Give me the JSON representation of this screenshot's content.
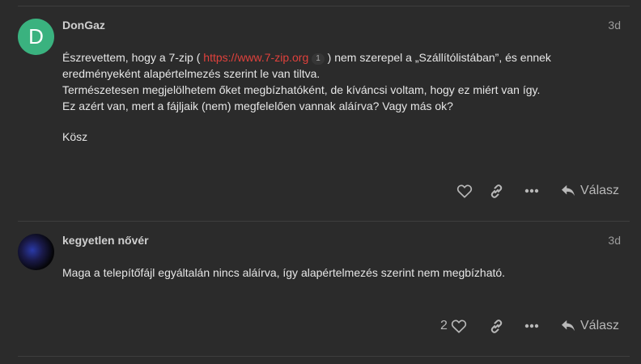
{
  "posts": [
    {
      "avatar_letter": "D",
      "username": "DonGaz",
      "date": "3d",
      "body": {
        "line1_before": "Észrevettem, hogy a 7-zip ( ",
        "link_text": "https://www.7-zip.org",
        "link_count": "1",
        "line1_after": " ) nem szerepel a „Szállítólistában”, és ennek eredményeként alapértelmezés szerint le van tiltva.",
        "line2": "Természetesen megjelölhetem őket megbízhatóként, de kíváncsi voltam, hogy ez miért van így.",
        "line3": "Ez azért van, mert a fájljaik (nem) megfelelően vannak aláírva? Vagy más ok?",
        "para2": "Kösz"
      },
      "like_count": "",
      "reply_label": "Válasz"
    },
    {
      "avatar_letter": "",
      "username": "kegyetlen nővér",
      "date": "3d",
      "body": {
        "para1": "Maga a telepítőfájl egyáltalán nincs aláírva, így alapértelmezés szerint nem megbízható."
      },
      "like_count": "2",
      "reply_label": "Válasz"
    }
  ],
  "icons": {
    "like": "heart-icon",
    "share": "link-icon",
    "more": "ellipsis-icon",
    "reply": "reply-arrow-icon"
  },
  "colors": {
    "background": "#2b2b2b",
    "avatar": "#3ab27f",
    "link": "#e0413c"
  }
}
